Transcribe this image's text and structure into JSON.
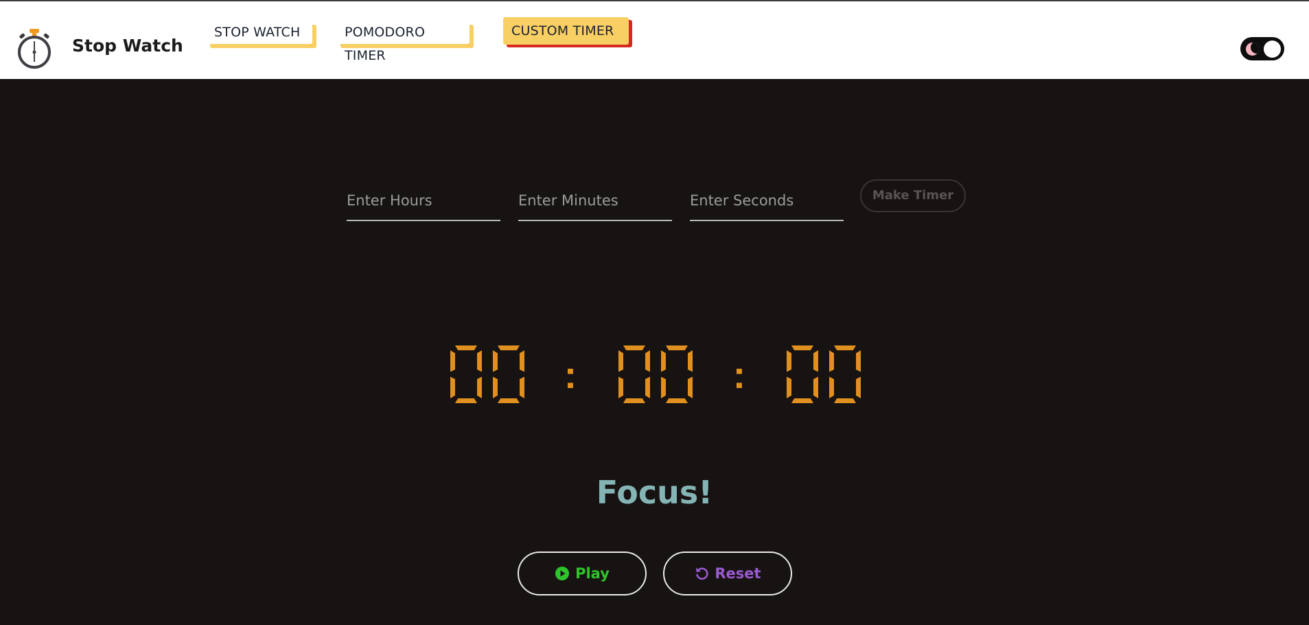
{
  "app": {
    "brand": "Stop Watch",
    "logo_icon": "stopwatch-icon"
  },
  "nav": [
    {
      "label": "STOP WATCH",
      "active": false
    },
    {
      "label": "POMODORO TIMER",
      "active": false
    },
    {
      "label": "CUSTOM TIMER",
      "active": true
    }
  ],
  "theme_toggle": {
    "icon": "moon-icon",
    "state": "dark"
  },
  "form": {
    "hours_placeholder": "Enter Hours",
    "minutes_placeholder": "Enter Minutes",
    "seconds_placeholder": "Enter Seconds",
    "make_label": "Make Timer"
  },
  "timer": {
    "hours": "00",
    "minutes": "00",
    "seconds": "00",
    "separator": ":",
    "digit_color": "#e0901f"
  },
  "status": "Focus!",
  "controls": {
    "play_label": "Play",
    "reset_label": "Reset",
    "play_icon": "play-circle-icon",
    "reset_icon": "undo-icon"
  },
  "colors": {
    "background": "#181313",
    "accent": "#f8cf63",
    "active_shadow": "#d62a1f",
    "focus": "#84b4b4",
    "play": "#2ec52b",
    "reset": "#9a5ad0"
  }
}
